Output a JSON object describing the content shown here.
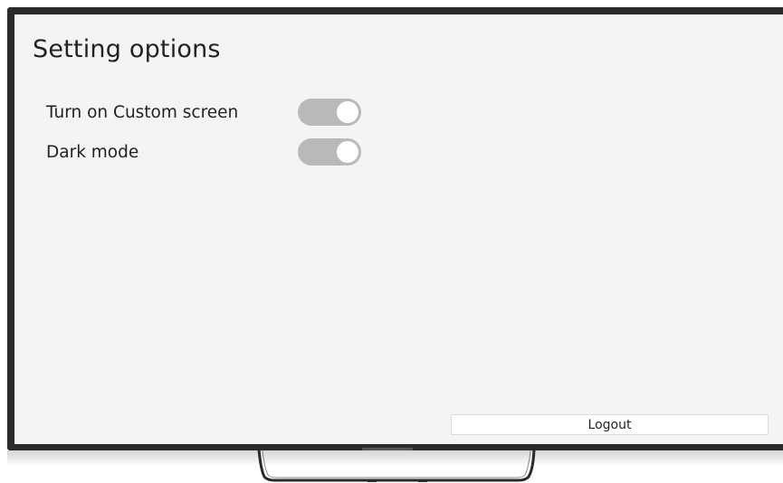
{
  "screen": {
    "title": "Setting options",
    "settings": [
      {
        "label": "Turn on Custom screen",
        "state": "on"
      },
      {
        "label": "Dark mode",
        "state": "on"
      }
    ],
    "logout_label": "Logout"
  },
  "colors": {
    "bezel": "#2b2b2b",
    "screen_background": "#f4f4f4",
    "toggle_track": "#b9b9b9",
    "toggle_knob": "#ffffff"
  }
}
